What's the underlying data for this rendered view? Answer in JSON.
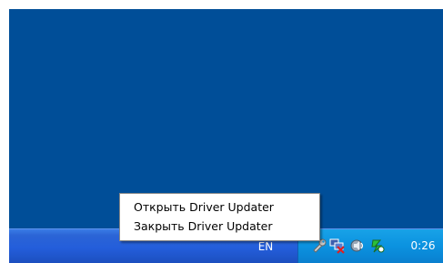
{
  "taskbar": {
    "language": "EN",
    "clock": "0:26"
  },
  "tray_icons": [
    {
      "name": "network-tool-icon"
    },
    {
      "name": "disconnected-network-icon"
    },
    {
      "name": "volume-icon"
    },
    {
      "name": "driver-updater-icon"
    }
  ],
  "context_menu": {
    "items": [
      "Открыть Driver Updater",
      "Закрыть Driver Updater"
    ]
  },
  "colors": {
    "desktop": "#004e98",
    "taskbar": "#245edb",
    "tray": "#0b92e0"
  }
}
